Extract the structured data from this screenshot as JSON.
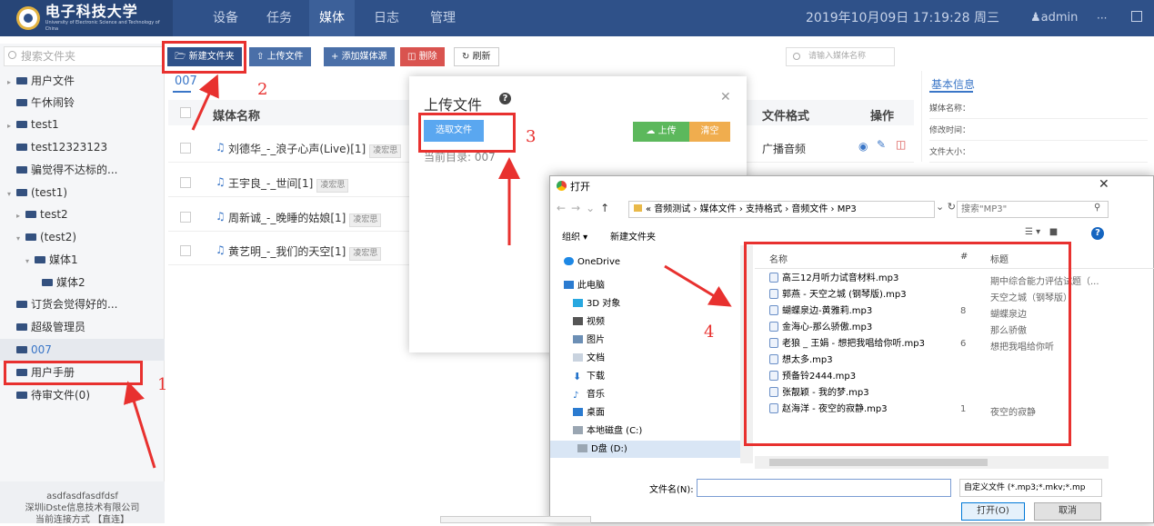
{
  "app": {
    "logo_text": "电子科技大学",
    "logo_sub": "University of Electronic Science and Technology of China",
    "nav": [
      "设备",
      "任务",
      "媒体",
      "日志",
      "管理"
    ],
    "nav_active": "媒体",
    "datetime": "2019年10月09日 17:19:28  周三",
    "user": "admin",
    "more": "···"
  },
  "sidebar": {
    "search_placeholder": "搜索文件夹",
    "items": [
      "用户文件",
      "午休闹铃",
      "test1",
      "test12323123",
      "骗觉得不达标的...",
      "(test1)",
      "test2",
      "(test2)",
      "媒体1",
      "媒体2",
      "订货会觉得好的...",
      "超级管理员",
      "007",
      "用户手册",
      "待审文件(0)"
    ],
    "footer": [
      "asdfasdfasdfdsf",
      "深圳iDste信息技术有限公司",
      "当前连接方式 【直连】"
    ]
  },
  "toolbar": {
    "new_folder": "新建文件夹",
    "upload": "上传文件",
    "add_media": "添加媒体源",
    "delete": "删除",
    "refresh": "刷新",
    "search_placeholder": "请输入媒体名称"
  },
  "main": {
    "crumb": "007",
    "col_name": "媒体名称",
    "col_format": "文件格式",
    "col_op": "操作",
    "rows": [
      {
        "name": "刘德华_-_浪子心声(Live)[1]",
        "tag": "凌宏思",
        "format": "广播音频"
      },
      {
        "name": "王宇良_-_世间[1]",
        "tag": "凌宏思"
      },
      {
        "name": "周新诚_-_晚睡的姑娘[1]",
        "tag": "凌宏思"
      },
      {
        "name": "黄艺明_-_我们的天空[1]",
        "tag": "凌宏思"
      }
    ]
  },
  "info": {
    "title": "基本信息",
    "rows": [
      "媒体名称：",
      "修改时间：",
      "文件大小："
    ]
  },
  "upload_dialog": {
    "title": "上传文件",
    "pick": "选取文件",
    "upload": "上传",
    "clear": "清空",
    "current_dir": "当前目录: 007"
  },
  "annotations": [
    "1",
    "2",
    "3",
    "4"
  ],
  "open_dialog": {
    "title": "打开",
    "path": "« 音频测试 › 媒体文件 › 支持格式 › 音频文件 › MP3",
    "search_placeholder": "搜索\"MP3\"",
    "organize": "组织 ▾",
    "new_folder": "新建文件夹",
    "nav": [
      "OneDrive",
      "此电脑",
      "3D 对象",
      "视频",
      "图片",
      "文档",
      "下载",
      "音乐",
      "桌面",
      "本地磁盘 (C:)",
      "D盘 (D:)"
    ],
    "col_name": "名称",
    "col_num": "#",
    "col_title": "标题",
    "files": [
      {
        "name": "高三12月听力试音材料.mp3",
        "num": "",
        "title": "期中综合能力评估试题（..."
      },
      {
        "name": "郭燕 - 天空之城 (钢琴版).mp3",
        "num": "",
        "title": "天空之城（钢琴版）"
      },
      {
        "name": "蝴蝶泉边-黄雅莉.mp3",
        "num": "8",
        "title": "蝴蝶泉边"
      },
      {
        "name": "金海心-那么骄傲.mp3",
        "num": "",
        "title": "那么骄傲"
      },
      {
        "name": "老狼 _ 王娟 - 想把我唱给你听.mp3",
        "num": "6",
        "title": "想把我唱给你听"
      },
      {
        "name": "想太多.mp3",
        "num": "",
        "title": ""
      },
      {
        "name": "预备铃2444.mp3",
        "num": "",
        "title": ""
      },
      {
        "name": "张靓颖 - 我的梦.mp3",
        "num": "",
        "title": ""
      },
      {
        "name": "赵海洋 - 夜空的寂静.mp3",
        "num": "1",
        "title": "夜空的寂静"
      }
    ],
    "filename_label": "文件名(N):",
    "filetype": "自定义文件 (*.mp3;*.mkv;*.mp",
    "open": "打开(O)",
    "cancel": "取消"
  }
}
